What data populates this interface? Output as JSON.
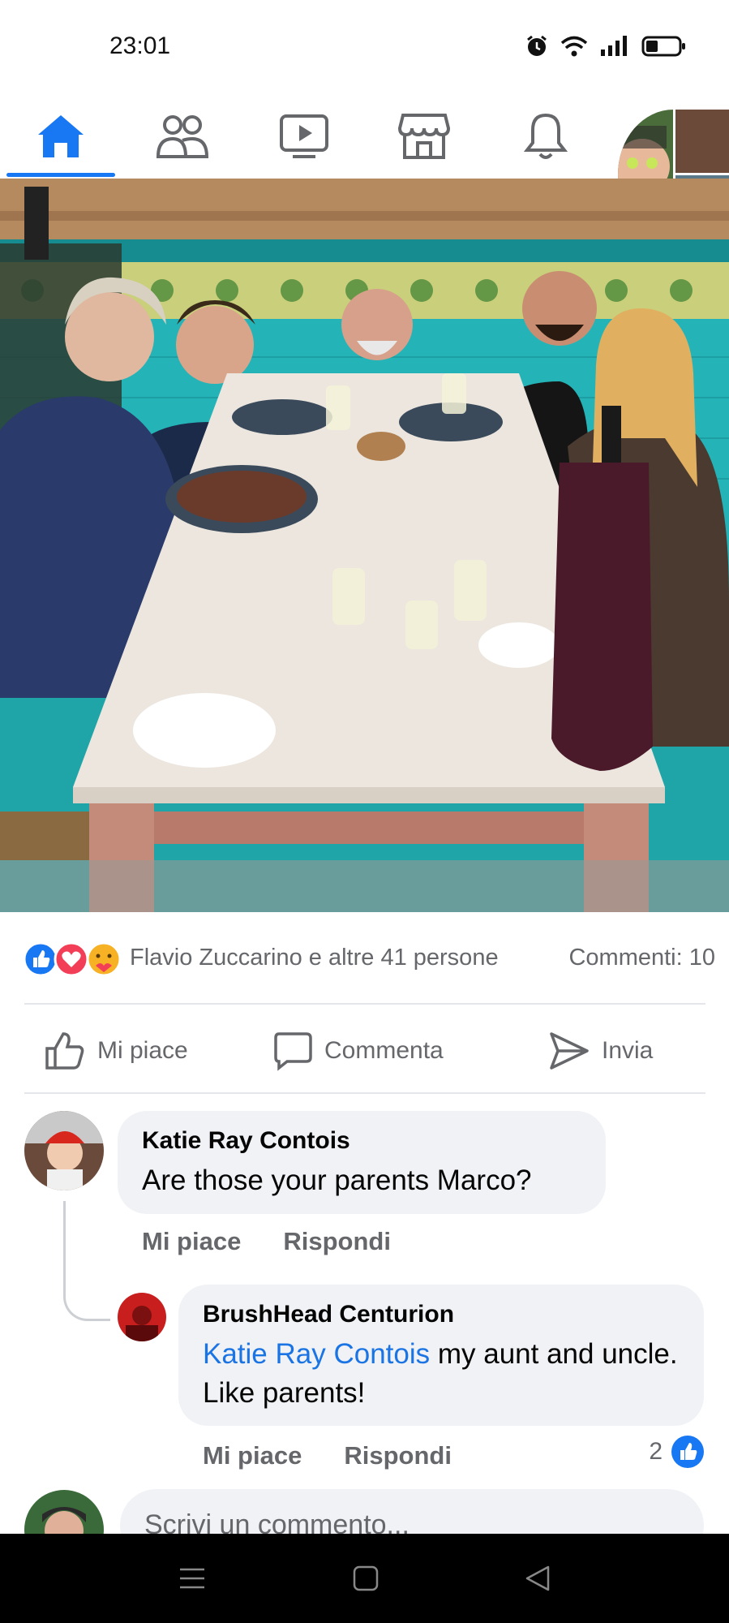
{
  "status_bar": {
    "time": "23:01"
  },
  "nav": {
    "tabs": [
      "home",
      "friends",
      "watch",
      "marketplace",
      "notifications",
      "profile"
    ],
    "active": "home",
    "accent": "#1877f2"
  },
  "post": {
    "reactions": {
      "types": [
        "like",
        "love",
        "care"
      ],
      "text": "Flavio Zuccarino e altre 41 persone"
    },
    "comments_count": "Commenti: 10",
    "actions": {
      "like": "Mi piace",
      "comment": "Commenta",
      "send": "Invia"
    }
  },
  "comments": [
    {
      "author": "Katie Ray Contois",
      "text": "Are those your parents Marco?",
      "like_label": "Mi piace",
      "reply_label": "Rispondi"
    },
    {
      "author": "BrushHead Centurion",
      "mention": "Katie Ray Contois",
      "text": " my aunt and uncle.  Like parents!",
      "like_label": "Mi piace",
      "reply_label": "Rispondi",
      "likes": "2"
    }
  ],
  "write_comment": {
    "placeholder": "Scrivi un commento..."
  }
}
